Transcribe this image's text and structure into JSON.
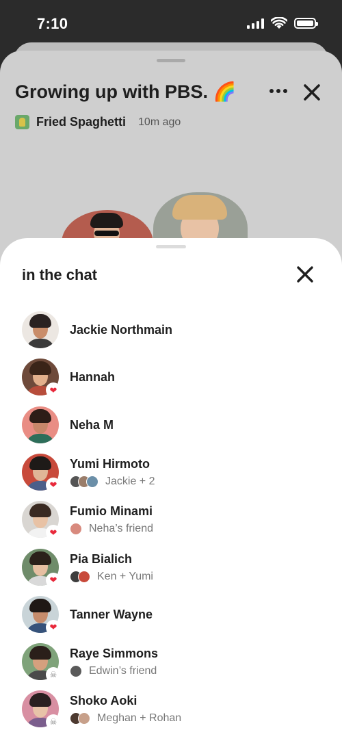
{
  "status_bar": {
    "time": "7:10"
  },
  "room": {
    "title": "Growing up with PBS. 🌈",
    "host_name": "Fried Spaghetti",
    "time_ago": "10m ago"
  },
  "chat_sheet": {
    "title": "in the chat",
    "people": [
      {
        "name": "Jackie Northmain",
        "subtitle": "",
        "badge": "",
        "colors": {
          "bg": "#ece7e2",
          "skin": "#c98d6a",
          "hair": "#2a2221",
          "body": "#3b3b3b"
        }
      },
      {
        "name": "Hannah",
        "subtitle": "",
        "badge": "heart",
        "colors": {
          "bg": "#6e4a3a",
          "skin": "#e2b08c",
          "hair": "#3a2418",
          "body": "#b74d3b"
        }
      },
      {
        "name": "Neha M",
        "subtitle": "",
        "badge": "",
        "colors": {
          "bg": "#e98d84",
          "skin": "#c8876a",
          "hair": "#2d1d17",
          "body": "#2d6e5a"
        }
      },
      {
        "name": "Yumi Hirmoto",
        "subtitle": "Jackie + 2",
        "badge": "heart",
        "colors": {
          "bg": "#c84a3b",
          "skin": "#e0b597",
          "hair": "#1e1a18",
          "body": "#4b5f8a"
        },
        "mini": [
          "#555555",
          "#9a7d6a",
          "#6b8fa8"
        ]
      },
      {
        "name": "Fumio Minami",
        "subtitle": "Neha’s friend",
        "badge": "heart",
        "colors": {
          "bg": "#d9d6d2",
          "skin": "#e8c2a5",
          "hair": "#3a2a22",
          "body": "#f2f2f2"
        },
        "mini": [
          "#d88a7e"
        ]
      },
      {
        "name": "Pia Bialich",
        "subtitle": "Ken + Yumi",
        "badge": "heart",
        "colors": {
          "bg": "#6f8c6a",
          "skin": "#e6bfa2",
          "hair": "#2b201a",
          "body": "#d9d9d9"
        },
        "mini": [
          "#3d3d3d",
          "#c84a3b"
        ]
      },
      {
        "name": "Tanner Wayne",
        "subtitle": "",
        "badge": "heart",
        "colors": {
          "bg": "#c9d4d8",
          "skin": "#c68c6c",
          "hair": "#1f1815",
          "body": "#36527a"
        }
      },
      {
        "name": "Raye Simmons",
        "subtitle": "Edwin’s friend",
        "badge": "skull",
        "colors": {
          "bg": "#7fa37a",
          "skin": "#d5a07e",
          "hair": "#2a1f1a",
          "body": "#4a4a4a"
        },
        "mini": [
          "#5a5a5a"
        ]
      },
      {
        "name": "Shoko Aoki",
        "subtitle": "Meghan + Rohan",
        "badge": "skull",
        "colors": {
          "bg": "#d88fa2",
          "skin": "#e8c3a8",
          "hair": "#2a2020",
          "body": "#7b5e8d"
        },
        "mini": [
          "#4d3a30",
          "#c7a08a"
        ]
      }
    ]
  }
}
